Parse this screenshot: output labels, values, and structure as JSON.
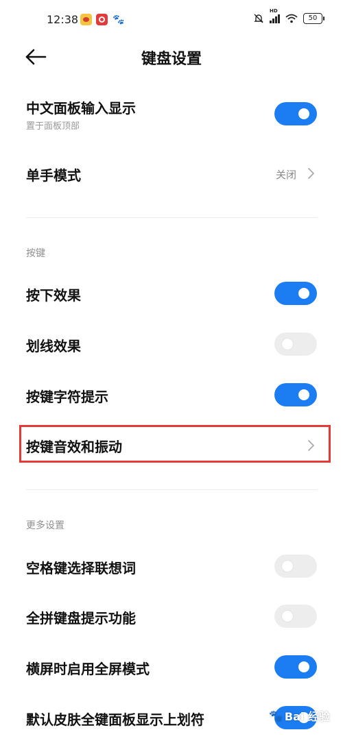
{
  "status_bar": {
    "time": "12:38",
    "battery": "50",
    "hd_label": "HD"
  },
  "header": {
    "title": "键盘设置"
  },
  "top_settings": [
    {
      "label": "中文面板输入显示",
      "sub": "置于面板顶部",
      "toggle": true
    },
    {
      "label": "单手模式",
      "value": "关闭"
    }
  ],
  "sections": [
    {
      "title": "按键",
      "items": [
        {
          "label": "按下效果",
          "toggle": true
        },
        {
          "label": "划线效果",
          "toggle": false
        },
        {
          "label": "按键字符提示",
          "toggle": true
        },
        {
          "label": "按键音效和振动"
        }
      ]
    },
    {
      "title": "更多设置",
      "items": [
        {
          "label": "空格键选择联想词",
          "toggle": false
        },
        {
          "label": "全拼键盘提示功能",
          "toggle": false
        },
        {
          "label": "横屏时启用全屏模式",
          "toggle": true
        },
        {
          "label": "默认皮肤全键面板显示上划符",
          "toggle": true
        }
      ]
    }
  ],
  "watermark": {
    "text": "Bai 经验"
  },
  "colors": {
    "toggle_on": "#1c7cf2",
    "toggle_off": "#ededed",
    "highlight": "#e53935"
  }
}
